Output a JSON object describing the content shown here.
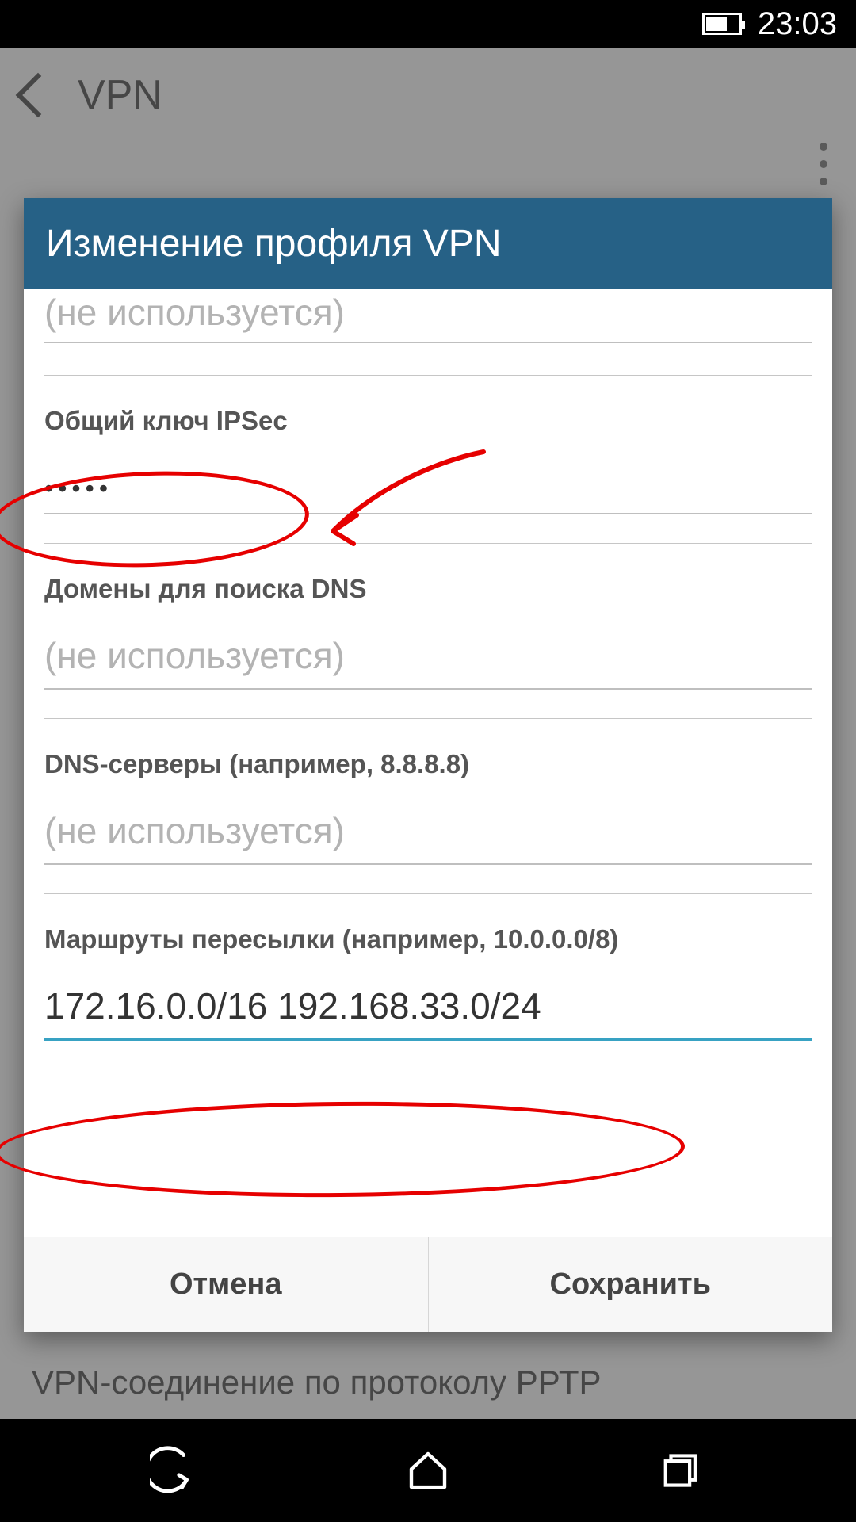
{
  "statusbar": {
    "time": "23:03"
  },
  "app": {
    "title": "VPN",
    "behind_text": "VPN-соединение по протоколу РРТР"
  },
  "dialog": {
    "title": "Изменение профиля VPN",
    "fields": {
      "cutoff_placeholder": "(не используется)",
      "ipsec_key": {
        "label": "Общий ключ IPSec",
        "value": "•••••"
      },
      "dns_domains": {
        "label": "Домены для поиска DNS",
        "placeholder": "(не используется)",
        "value": ""
      },
      "dns_servers": {
        "label": "DNS-серверы (например, 8.8.8.8)",
        "placeholder": "(не используется)",
        "value": ""
      },
      "routes": {
        "label": "Маршруты пересылки (например, 10.0.0.0/8)",
        "value": "172.16.0.0/16 192.168.33.0/24"
      }
    },
    "buttons": {
      "cancel": "Отмена",
      "save": "Сохранить"
    }
  }
}
